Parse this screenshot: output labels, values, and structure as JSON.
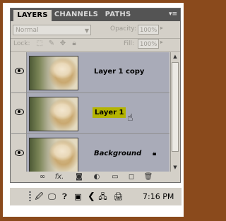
{
  "tabs": [
    {
      "label": "LAYERS",
      "active": true
    },
    {
      "label": "CHANNELS",
      "active": false
    },
    {
      "label": "PATHS",
      "active": false
    }
  ],
  "menu_icon": "panel-menu-icon",
  "blend_mode": "Normal",
  "opacity_label": "Opacity:",
  "opacity_value": "100%",
  "lock_label": "Lock:",
  "fill_label": "Fill:",
  "fill_value": "100%",
  "layers": [
    {
      "name": "Layer 1 copy",
      "visible": true,
      "highlighted": false
    },
    {
      "name": "Layer 1",
      "visible": true,
      "highlighted": true
    },
    {
      "name": "Background",
      "visible": true,
      "locked": true
    }
  ],
  "footer_icons": [
    "link-layers-icon",
    "fx-icon",
    "mask-icon",
    "adjustment-icon",
    "group-icon",
    "new-layer-icon",
    "trash-icon"
  ],
  "fx_label": "fx.",
  "clock": "7:16 PM",
  "colors": {
    "highlight": "#b4b400",
    "layer_bg": "#a9abb8",
    "panel": "#d4d0c8"
  }
}
